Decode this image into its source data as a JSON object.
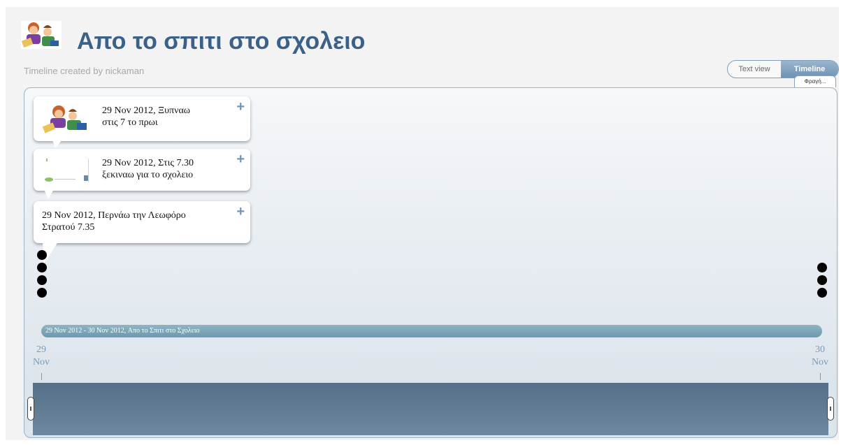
{
  "header": {
    "title": "Απο το σπιτι στο σχολειο",
    "subtitle": "Timeline created by nickaman"
  },
  "view_toggle": {
    "text_view_label": "Text view",
    "timeline_label": "Timeline",
    "active": "Timeline"
  },
  "search_tab": {
    "label": "Φραγή..."
  },
  "events": [
    {
      "date": "29 Nov 2012,",
      "title_line1": "Ξυπναω",
      "title_line2": "στις 7 το πρωι",
      "has_image": true,
      "image": "cartoon-kids-icon"
    },
    {
      "date": "29 Nov 2012,",
      "title_line1": "Στις 7.30",
      "title_line2": "ξεκιναω για το σχολειο",
      "has_image": true,
      "image": "screenshot-thumbnail"
    },
    {
      "date": "29 Nov 2012,",
      "title_line1": "Περνάω την Λεωφόρο",
      "title_line2": "Στρατού 7.35",
      "has_image": false
    }
  ],
  "expand_icon": "+",
  "era_bar": {
    "label": "29 Nov 2012 - 30 Nov 2012, Απο το Σπιτι στο Σχολειο"
  },
  "axis": {
    "start": {
      "day": "29",
      "month": "Nov"
    },
    "end": {
      "day": "30",
      "month": "Nov"
    }
  },
  "colors": {
    "title": "#3b6189",
    "accent": "#6f92b3",
    "era_bar": "#7aa3b6",
    "overview": "#5e7890"
  }
}
